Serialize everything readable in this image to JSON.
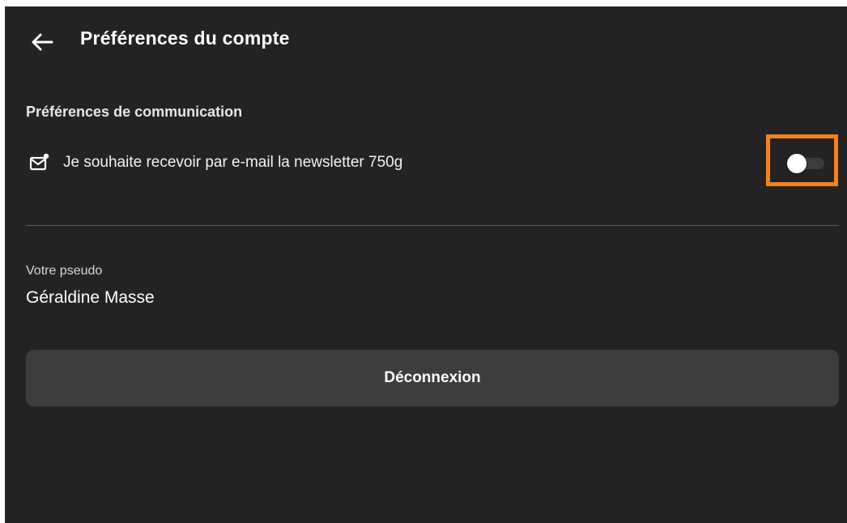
{
  "header": {
    "back_icon": "arrow-left-icon",
    "title": "Préférences du compte"
  },
  "communication": {
    "section_title": "Préférences de communication",
    "newsletter": {
      "icon": "mail-notification-icon",
      "label": "Je souhaite recevoir par e-mail la newsletter 750g",
      "enabled": false
    }
  },
  "profile": {
    "pseudo_label": "Votre pseudo",
    "pseudo_value": "Géraldine Masse"
  },
  "actions": {
    "logout_label": "Déconnexion"
  },
  "colors": {
    "background": "#232323",
    "highlight": "#f7821b",
    "button": "#3d3d3d"
  }
}
